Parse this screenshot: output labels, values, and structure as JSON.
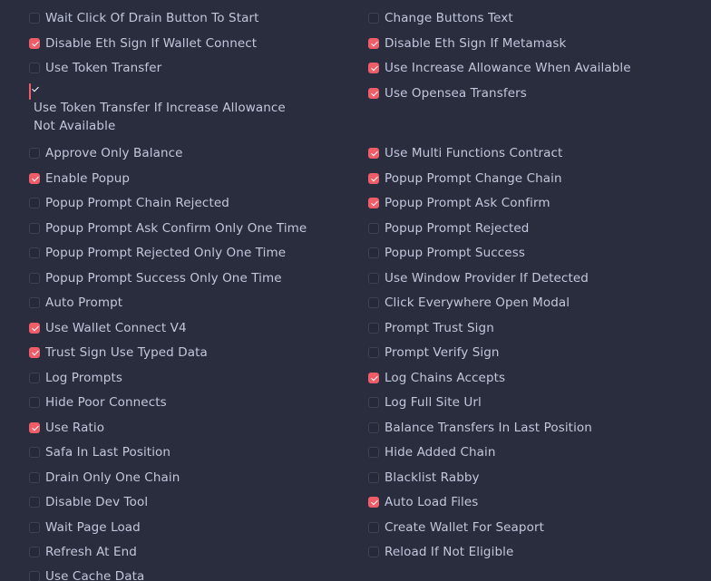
{
  "left": [
    {
      "label": "Wait Click Of Drain Button To Start",
      "checked": false
    },
    {
      "label": "Disable Eth Sign If Wallet Connect",
      "checked": true
    },
    {
      "label": "Use Token Transfer",
      "checked": false
    },
    {
      "label": "Use Token Transfer If Increase Allowance Not Available",
      "checked": true
    },
    {
      "label": "Approve Only Balance",
      "checked": false
    },
    {
      "label": "Enable Popup",
      "checked": true
    },
    {
      "label": "Popup Prompt Chain Rejected",
      "checked": false
    },
    {
      "label": "Popup Prompt Ask Confirm Only One Time",
      "checked": false
    },
    {
      "label": "Popup Prompt Rejected Only One Time",
      "checked": false
    },
    {
      "label": "Popup Prompt Success Only One Time",
      "checked": false
    },
    {
      "label": "Auto Prompt",
      "checked": false
    },
    {
      "label": "Use Wallet Connect V4",
      "checked": true
    },
    {
      "label": "Trust Sign Use Typed Data",
      "checked": true
    },
    {
      "label": "Log Prompts",
      "checked": false
    },
    {
      "label": "Hide Poor Connects",
      "checked": false
    },
    {
      "label": "Use Ratio",
      "checked": true
    },
    {
      "label": "Safa In Last Position",
      "checked": false
    },
    {
      "label": "Drain Only One Chain",
      "checked": false
    },
    {
      "label": "Disable Dev Tool",
      "checked": false
    },
    {
      "label": "Wait Page Load",
      "checked": false
    },
    {
      "label": "Refresh At End",
      "checked": false
    },
    {
      "label": "Use Cache Data",
      "checked": false
    }
  ],
  "right": [
    {
      "label": "Change Buttons Text",
      "checked": false
    },
    {
      "label": "Disable Eth Sign If Metamask",
      "checked": true
    },
    {
      "label": "Use Increase Allowance When Available",
      "checked": true
    },
    {
      "label": "Use Opensea Transfers",
      "checked": true
    },
    {
      "label": "Use Multi Functions Contract",
      "checked": true
    },
    {
      "label": "Popup Prompt Change Chain",
      "checked": true
    },
    {
      "label": "Popup Prompt Ask Confirm",
      "checked": true
    },
    {
      "label": "Popup Prompt Rejected",
      "checked": false
    },
    {
      "label": "Popup Prompt Success",
      "checked": false
    },
    {
      "label": "Use Window Provider If Detected",
      "checked": false
    },
    {
      "label": "Click Everywhere Open Modal",
      "checked": false
    },
    {
      "label": "Prompt Trust Sign",
      "checked": false
    },
    {
      "label": "Prompt Verify Sign",
      "checked": false
    },
    {
      "label": "Log Chains Accepts",
      "checked": true
    },
    {
      "label": "Log Full Site Url",
      "checked": false
    },
    {
      "label": "Balance Transfers In Last Position",
      "checked": false
    },
    {
      "label": "Hide Added Chain",
      "checked": false
    },
    {
      "label": "Blacklist Rabby",
      "checked": false
    },
    {
      "label": "Auto Load Files",
      "checked": true
    },
    {
      "label": "Create Wallet For Seaport",
      "checked": false
    },
    {
      "label": "Reload If Not Eligible",
      "checked": false
    }
  ],
  "colors": {
    "background": "#2a2d3e",
    "text": "#c3c7dc",
    "accent": "#ee5d68",
    "box_border": "#3e4256"
  },
  "icons": {
    "checked": "checkmark-icon",
    "unchecked": "empty-box-icon"
  }
}
